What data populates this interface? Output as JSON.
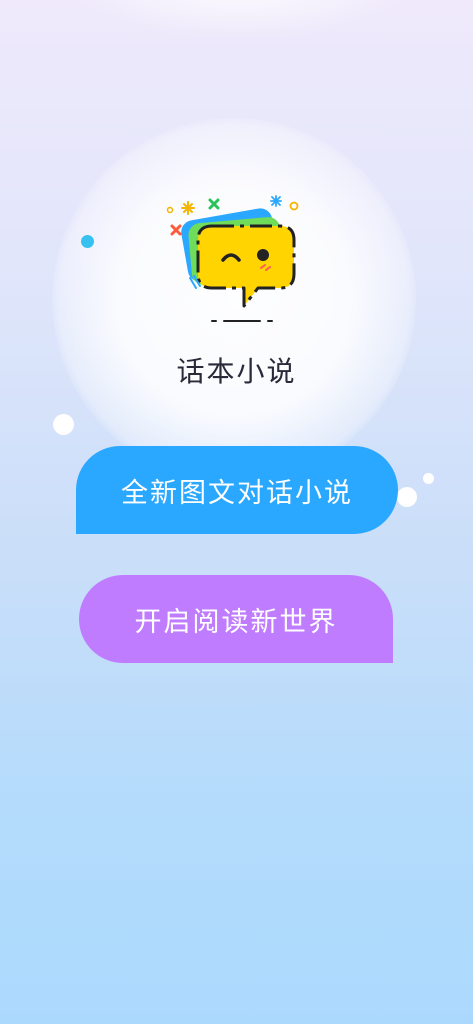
{
  "app": {
    "name": "话本小说"
  },
  "bubbles": {
    "first": "全新图文对话小说",
    "second": "开启阅读新世界"
  },
  "colors": {
    "blue_bubble": "#2aa8ff",
    "purple_bubble": "#c07cff",
    "logo_yellow": "#ffd400",
    "logo_green": "#6fdc5a",
    "logo_blue": "#2aa8ff",
    "background_top": "#efe9fb",
    "background_bottom": "#abd9fd"
  },
  "icons": {
    "logo": "winking-speech-bubble-icon"
  }
}
